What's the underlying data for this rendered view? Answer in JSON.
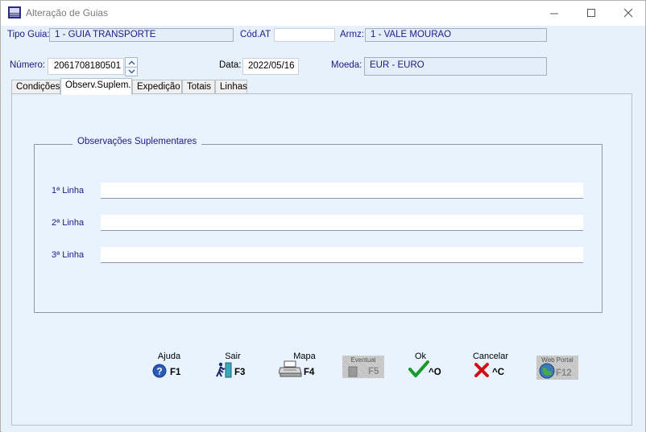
{
  "window": {
    "title": "Alteração de Guias"
  },
  "header": {
    "tipo_guia_label": "Tipo Guia:",
    "tipo_guia_value": "1 - GUIA TRANSPORTE",
    "cod_at_label": "Cód.AT",
    "cod_at_value": "",
    "armz_label": "Armz:",
    "armz_value": "1 - VALE MOURAO",
    "numero_label": "Número:",
    "numero_value": "2061708180501",
    "data_label": "Data:",
    "data_value": "2022/05/16",
    "moeda_label": "Moeda:",
    "moeda_value": "EUR - EURO"
  },
  "tabs": [
    {
      "label": "Condições",
      "active": false
    },
    {
      "label": "Observ.Suplem.",
      "active": true
    },
    {
      "label": "Expedição",
      "active": false
    },
    {
      "label": "Totais",
      "active": false
    },
    {
      "label": "Linhas",
      "active": false
    }
  ],
  "observacoes": {
    "group_title": "Observações Suplementares",
    "lines": [
      {
        "label": "1ª Linha",
        "value": ""
      },
      {
        "label": "2ª Linha",
        "value": ""
      },
      {
        "label": "3ª Linha",
        "value": ""
      }
    ]
  },
  "toolbar": {
    "ajuda": {
      "label": "Ajuda",
      "key": "F1"
    },
    "sair": {
      "label": "Sair",
      "key": "F3"
    },
    "mapa": {
      "label": "Mapa",
      "key": "F4"
    },
    "f5": {
      "label": "Eventual",
      "key": "F5"
    },
    "ok": {
      "label": "Ok",
      "key": "^O"
    },
    "cancelar": {
      "label": "Cancelar",
      "key": "^C"
    },
    "f12": {
      "label": "Web Portal",
      "key": "F12"
    }
  },
  "colors": {
    "client_bg": "#e6f1fb",
    "label_text": "#1a1a8a",
    "ok_green": "#1a9a2a",
    "cancel_red": "#d01010"
  }
}
